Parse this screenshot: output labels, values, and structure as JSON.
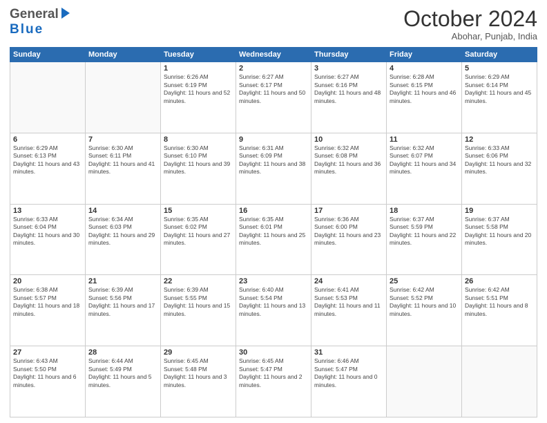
{
  "header": {
    "logo_general": "General",
    "logo_blue": "Blue",
    "month_title": "October 2024",
    "subtitle": "Abohar, Punjab, India"
  },
  "days_of_week": [
    "Sunday",
    "Monday",
    "Tuesday",
    "Wednesday",
    "Thursday",
    "Friday",
    "Saturday"
  ],
  "weeks": [
    [
      {
        "day": "",
        "sunrise": "",
        "sunset": "",
        "daylight": ""
      },
      {
        "day": "",
        "sunrise": "",
        "sunset": "",
        "daylight": ""
      },
      {
        "day": "1",
        "sunrise": "Sunrise: 6:26 AM",
        "sunset": "Sunset: 6:19 PM",
        "daylight": "Daylight: 11 hours and 52 minutes."
      },
      {
        "day": "2",
        "sunrise": "Sunrise: 6:27 AM",
        "sunset": "Sunset: 6:17 PM",
        "daylight": "Daylight: 11 hours and 50 minutes."
      },
      {
        "day": "3",
        "sunrise": "Sunrise: 6:27 AM",
        "sunset": "Sunset: 6:16 PM",
        "daylight": "Daylight: 11 hours and 48 minutes."
      },
      {
        "day": "4",
        "sunrise": "Sunrise: 6:28 AM",
        "sunset": "Sunset: 6:15 PM",
        "daylight": "Daylight: 11 hours and 46 minutes."
      },
      {
        "day": "5",
        "sunrise": "Sunrise: 6:29 AM",
        "sunset": "Sunset: 6:14 PM",
        "daylight": "Daylight: 11 hours and 45 minutes."
      }
    ],
    [
      {
        "day": "6",
        "sunrise": "Sunrise: 6:29 AM",
        "sunset": "Sunset: 6:13 PM",
        "daylight": "Daylight: 11 hours and 43 minutes."
      },
      {
        "day": "7",
        "sunrise": "Sunrise: 6:30 AM",
        "sunset": "Sunset: 6:11 PM",
        "daylight": "Daylight: 11 hours and 41 minutes."
      },
      {
        "day": "8",
        "sunrise": "Sunrise: 6:30 AM",
        "sunset": "Sunset: 6:10 PM",
        "daylight": "Daylight: 11 hours and 39 minutes."
      },
      {
        "day": "9",
        "sunrise": "Sunrise: 6:31 AM",
        "sunset": "Sunset: 6:09 PM",
        "daylight": "Daylight: 11 hours and 38 minutes."
      },
      {
        "day": "10",
        "sunrise": "Sunrise: 6:32 AM",
        "sunset": "Sunset: 6:08 PM",
        "daylight": "Daylight: 11 hours and 36 minutes."
      },
      {
        "day": "11",
        "sunrise": "Sunrise: 6:32 AM",
        "sunset": "Sunset: 6:07 PM",
        "daylight": "Daylight: 11 hours and 34 minutes."
      },
      {
        "day": "12",
        "sunrise": "Sunrise: 6:33 AM",
        "sunset": "Sunset: 6:06 PM",
        "daylight": "Daylight: 11 hours and 32 minutes."
      }
    ],
    [
      {
        "day": "13",
        "sunrise": "Sunrise: 6:33 AM",
        "sunset": "Sunset: 6:04 PM",
        "daylight": "Daylight: 11 hours and 30 minutes."
      },
      {
        "day": "14",
        "sunrise": "Sunrise: 6:34 AM",
        "sunset": "Sunset: 6:03 PM",
        "daylight": "Daylight: 11 hours and 29 minutes."
      },
      {
        "day": "15",
        "sunrise": "Sunrise: 6:35 AM",
        "sunset": "Sunset: 6:02 PM",
        "daylight": "Daylight: 11 hours and 27 minutes."
      },
      {
        "day": "16",
        "sunrise": "Sunrise: 6:35 AM",
        "sunset": "Sunset: 6:01 PM",
        "daylight": "Daylight: 11 hours and 25 minutes."
      },
      {
        "day": "17",
        "sunrise": "Sunrise: 6:36 AM",
        "sunset": "Sunset: 6:00 PM",
        "daylight": "Daylight: 11 hours and 23 minutes."
      },
      {
        "day": "18",
        "sunrise": "Sunrise: 6:37 AM",
        "sunset": "Sunset: 5:59 PM",
        "daylight": "Daylight: 11 hours and 22 minutes."
      },
      {
        "day": "19",
        "sunrise": "Sunrise: 6:37 AM",
        "sunset": "Sunset: 5:58 PM",
        "daylight": "Daylight: 11 hours and 20 minutes."
      }
    ],
    [
      {
        "day": "20",
        "sunrise": "Sunrise: 6:38 AM",
        "sunset": "Sunset: 5:57 PM",
        "daylight": "Daylight: 11 hours and 18 minutes."
      },
      {
        "day": "21",
        "sunrise": "Sunrise: 6:39 AM",
        "sunset": "Sunset: 5:56 PM",
        "daylight": "Daylight: 11 hours and 17 minutes."
      },
      {
        "day": "22",
        "sunrise": "Sunrise: 6:39 AM",
        "sunset": "Sunset: 5:55 PM",
        "daylight": "Daylight: 11 hours and 15 minutes."
      },
      {
        "day": "23",
        "sunrise": "Sunrise: 6:40 AM",
        "sunset": "Sunset: 5:54 PM",
        "daylight": "Daylight: 11 hours and 13 minutes."
      },
      {
        "day": "24",
        "sunrise": "Sunrise: 6:41 AM",
        "sunset": "Sunset: 5:53 PM",
        "daylight": "Daylight: 11 hours and 11 minutes."
      },
      {
        "day": "25",
        "sunrise": "Sunrise: 6:42 AM",
        "sunset": "Sunset: 5:52 PM",
        "daylight": "Daylight: 11 hours and 10 minutes."
      },
      {
        "day": "26",
        "sunrise": "Sunrise: 6:42 AM",
        "sunset": "Sunset: 5:51 PM",
        "daylight": "Daylight: 11 hours and 8 minutes."
      }
    ],
    [
      {
        "day": "27",
        "sunrise": "Sunrise: 6:43 AM",
        "sunset": "Sunset: 5:50 PM",
        "daylight": "Daylight: 11 hours and 6 minutes."
      },
      {
        "day": "28",
        "sunrise": "Sunrise: 6:44 AM",
        "sunset": "Sunset: 5:49 PM",
        "daylight": "Daylight: 11 hours and 5 minutes."
      },
      {
        "day": "29",
        "sunrise": "Sunrise: 6:45 AM",
        "sunset": "Sunset: 5:48 PM",
        "daylight": "Daylight: 11 hours and 3 minutes."
      },
      {
        "day": "30",
        "sunrise": "Sunrise: 6:45 AM",
        "sunset": "Sunset: 5:47 PM",
        "daylight": "Daylight: 11 hours and 2 minutes."
      },
      {
        "day": "31",
        "sunrise": "Sunrise: 6:46 AM",
        "sunset": "Sunset: 5:47 PM",
        "daylight": "Daylight: 11 hours and 0 minutes."
      },
      {
        "day": "",
        "sunrise": "",
        "sunset": "",
        "daylight": ""
      },
      {
        "day": "",
        "sunrise": "",
        "sunset": "",
        "daylight": ""
      }
    ]
  ]
}
